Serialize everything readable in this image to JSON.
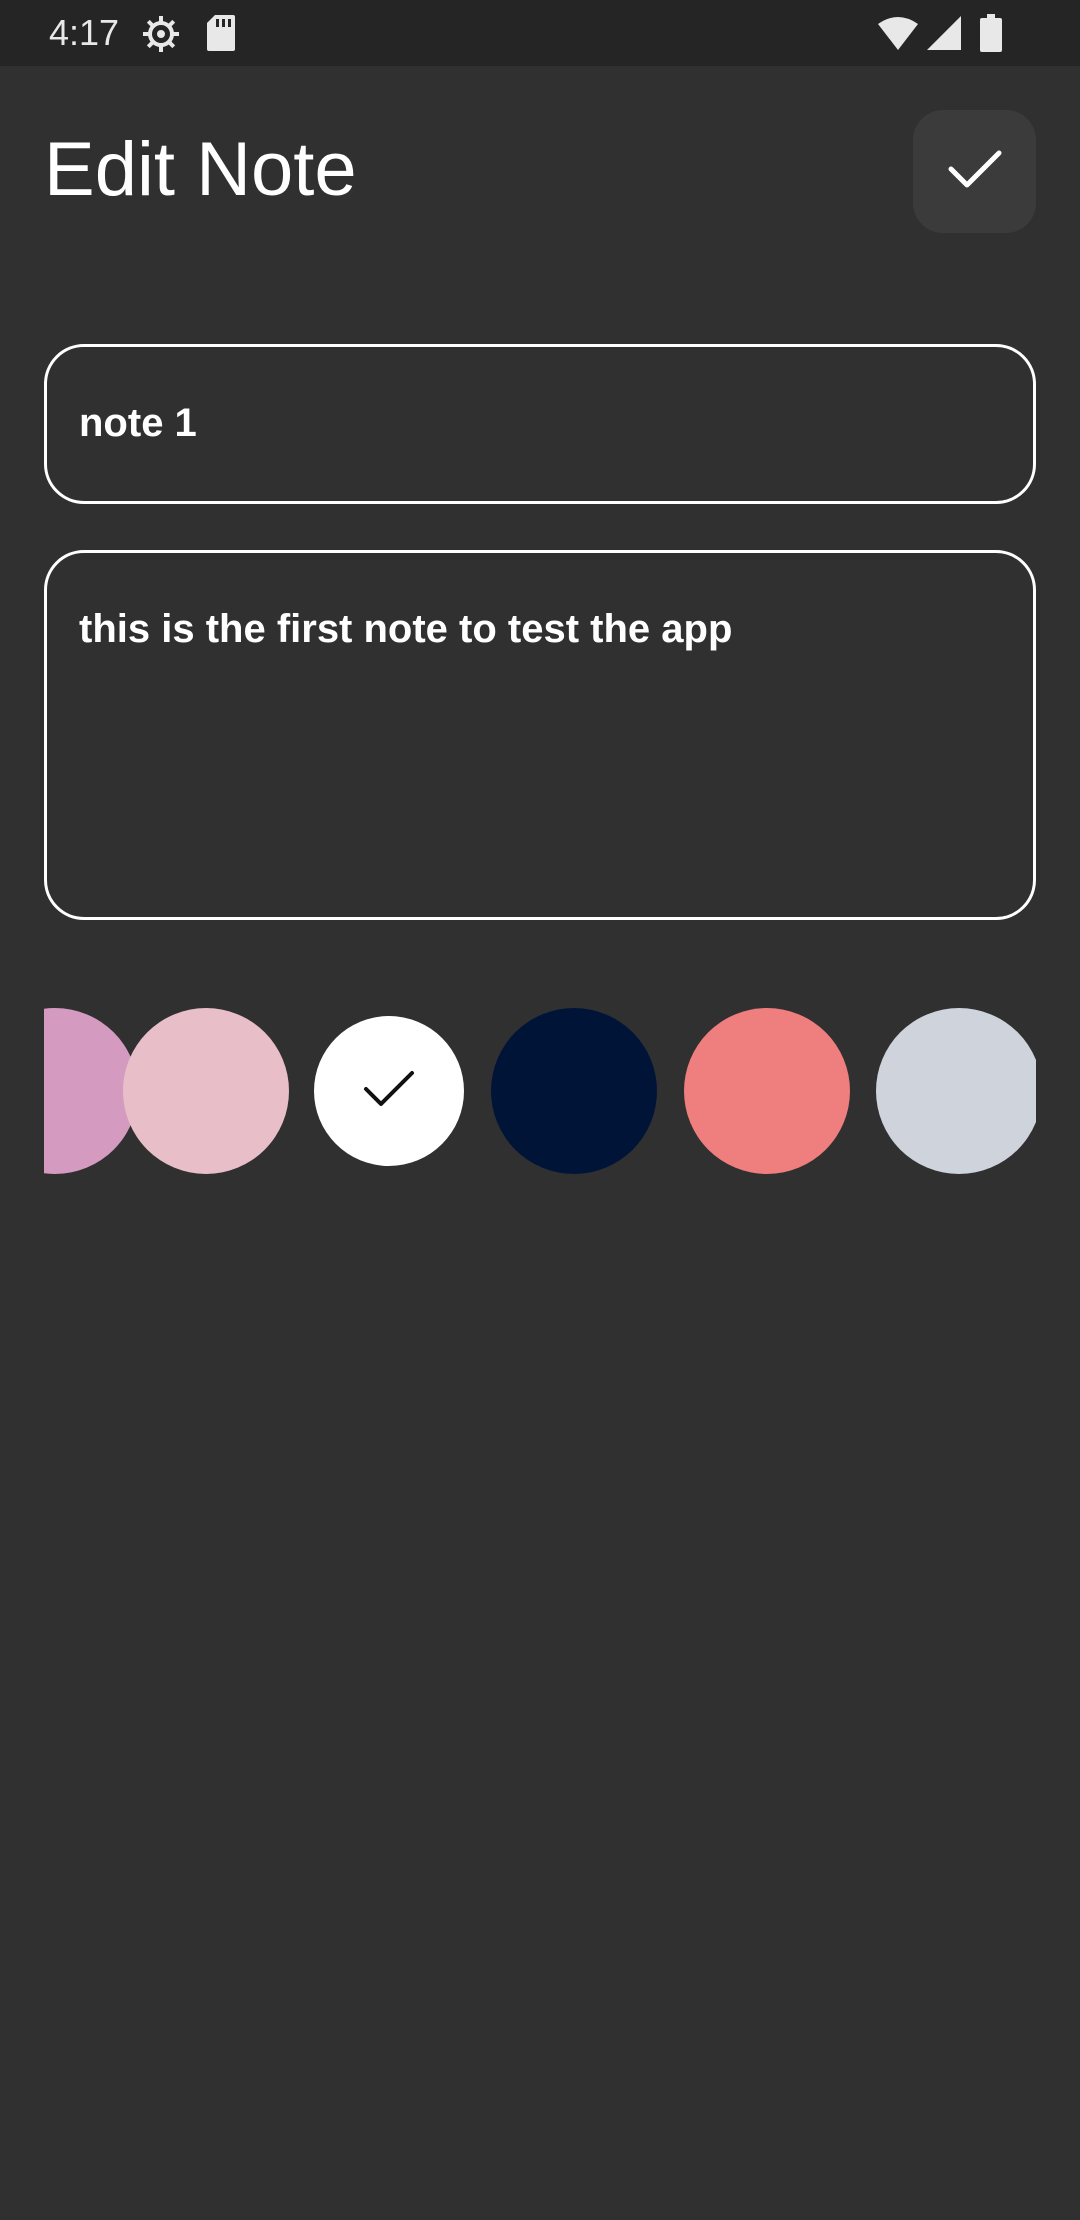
{
  "status_bar": {
    "time": "4:17",
    "icons": [
      "settings-icon",
      "sd-card-icon",
      "wifi-icon",
      "cell-signal-icon",
      "battery-icon"
    ]
  },
  "header": {
    "title": "Edit Note",
    "save_icon": "check-icon"
  },
  "note": {
    "title_value": "note 1",
    "content_value": "this is the first note to test the app"
  },
  "colors": {
    "swatches": [
      "#d49ac0",
      "#e8bfc8",
      "#ffffff",
      "#001438",
      "#ef7e7e",
      "#cfd4dc"
    ],
    "selected_index": 2
  },
  "theme": {
    "background": "#303030",
    "status_bar": "#252525",
    "button": "#3b3b3b",
    "text": "#ffffff"
  }
}
